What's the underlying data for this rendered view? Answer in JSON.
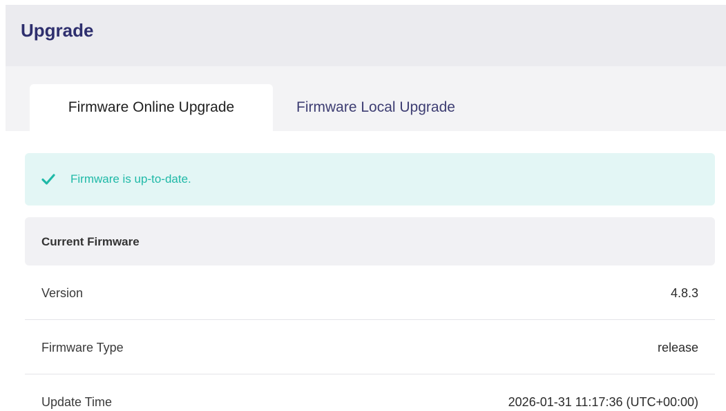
{
  "header": {
    "title": "Upgrade"
  },
  "tabs": [
    {
      "label": "Firmware Online Upgrade",
      "active": true
    },
    {
      "label": "Firmware Local Upgrade",
      "active": false
    }
  ],
  "alert": {
    "icon": "check-icon",
    "message": "Firmware is up-to-date.",
    "color": "#1fb9a7"
  },
  "current_firmware": {
    "title": "Current Firmware",
    "rows": [
      {
        "label": "Version",
        "value": "4.8.3"
      },
      {
        "label": "Firmware Type",
        "value": "release"
      },
      {
        "label": "Update Time",
        "value": "2026-01-31 11:17:36 (UTC+00:00)"
      }
    ]
  }
}
